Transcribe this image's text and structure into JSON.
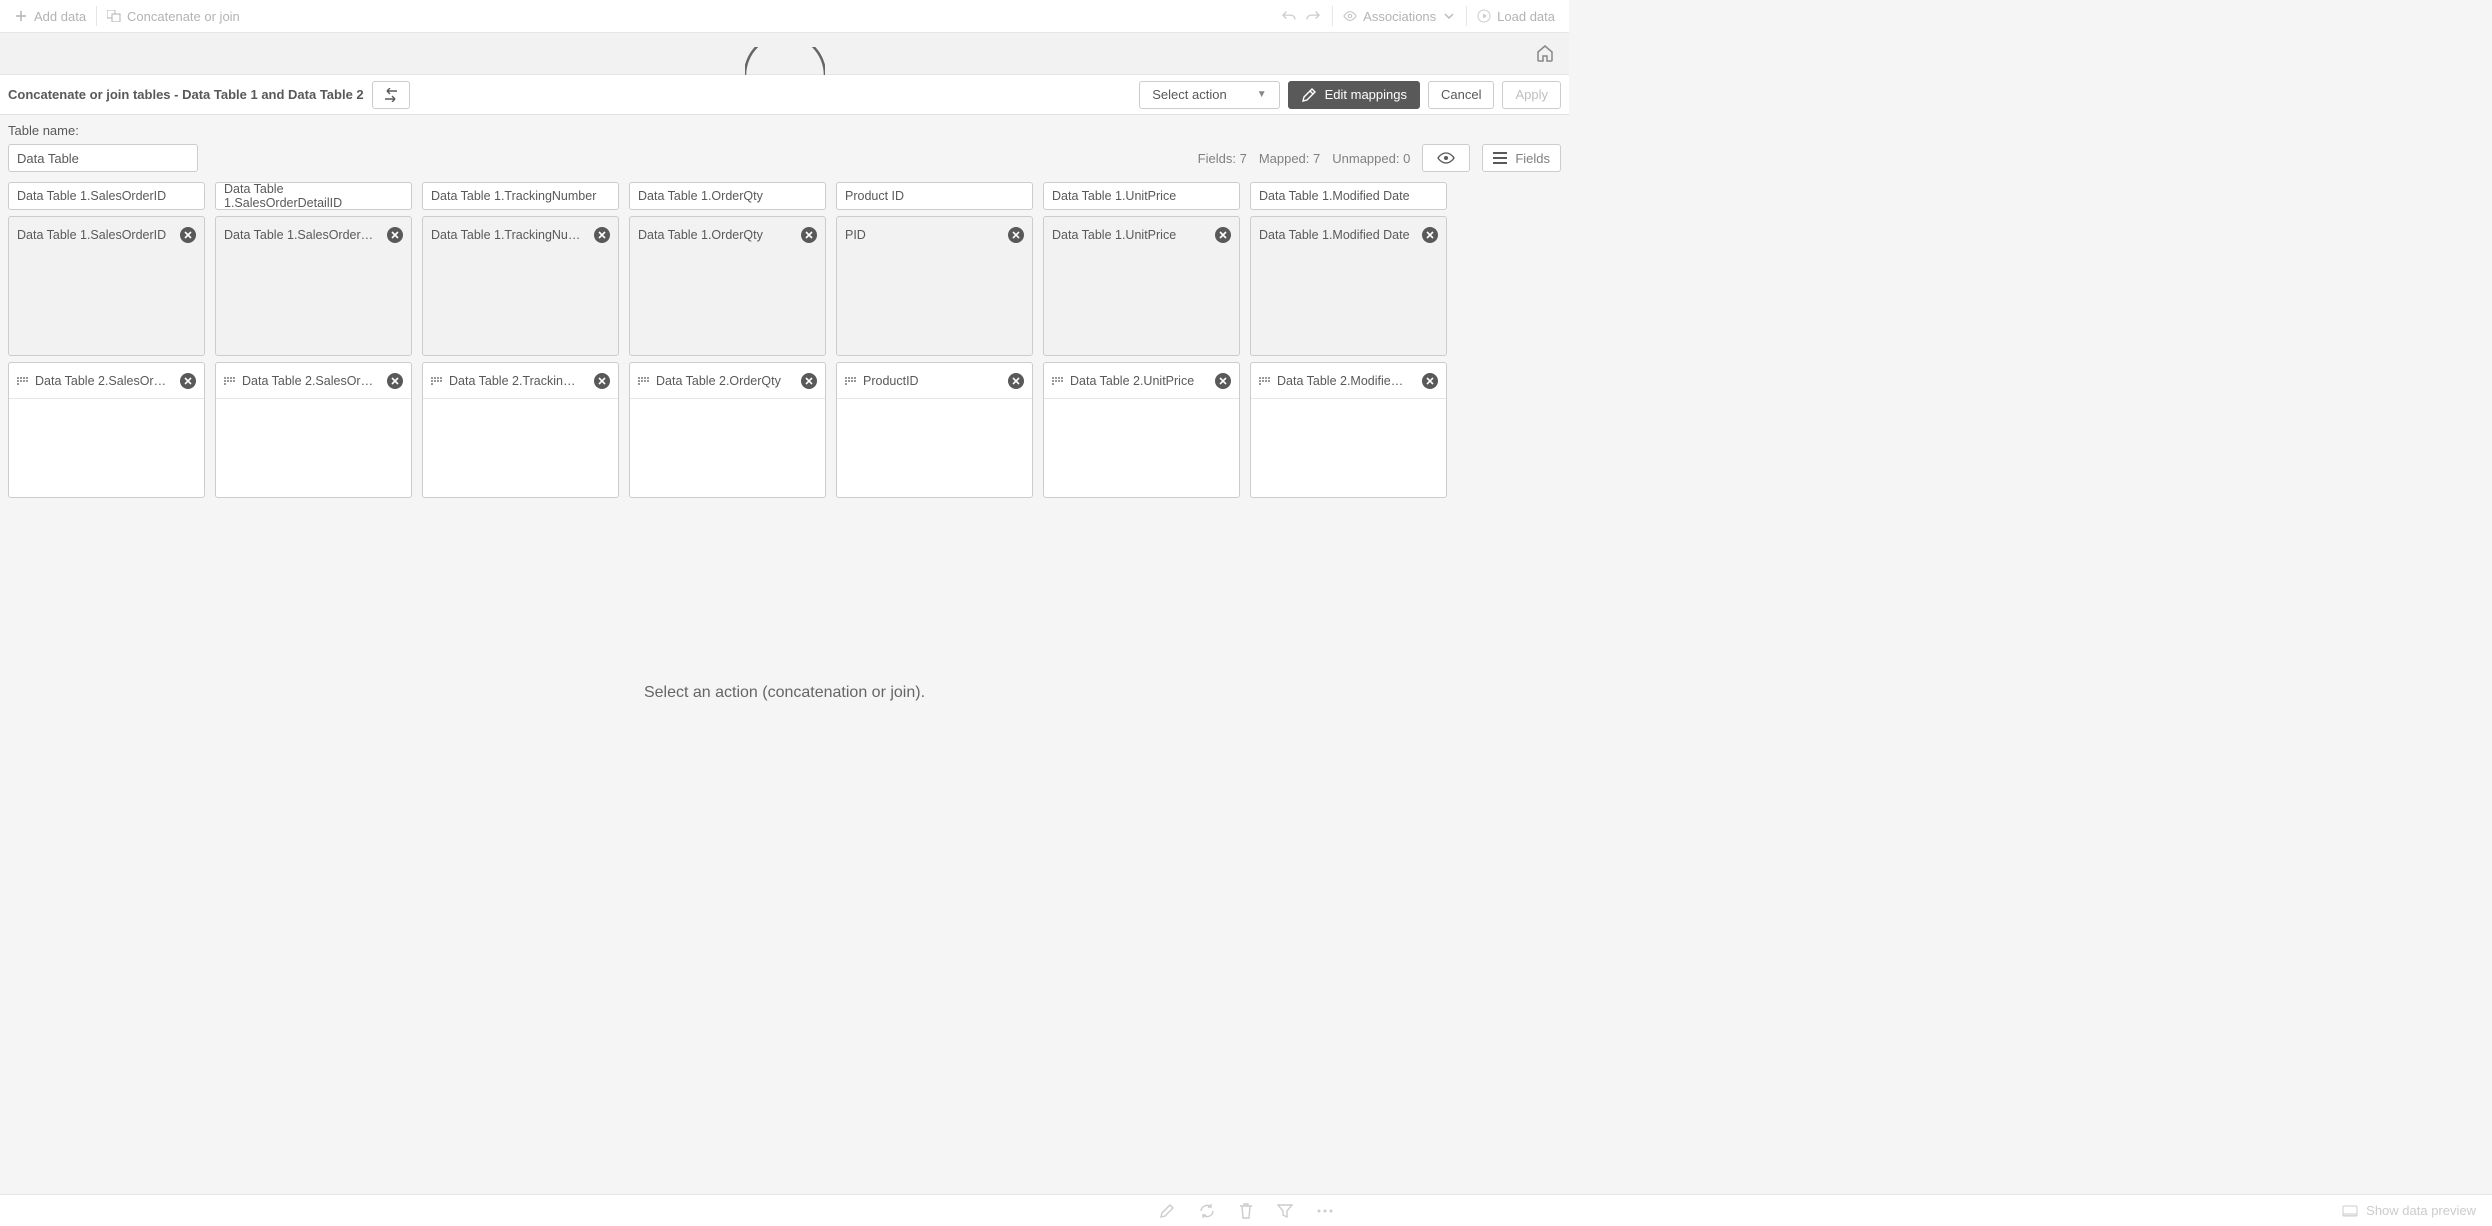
{
  "topbar": {
    "add_data": "Add data",
    "concat_join": "Concatenate or join",
    "associations": "Associations",
    "load_data": "Load data"
  },
  "actionbar": {
    "title": "Concatenate or join tables - Data Table 1 and Data Table 2",
    "select_action": "Select action",
    "edit_mappings": "Edit mappings",
    "cancel": "Cancel",
    "apply": "Apply"
  },
  "table_name": {
    "label": "Table name:",
    "value": "Data Table"
  },
  "stats": {
    "fields": "Fields: 7",
    "mapped": "Mapped: 7",
    "unmapped": "Unmapped: 0",
    "fields_btn": "Fields"
  },
  "columns": [
    {
      "header": "Data Table 1.SalesOrderID",
      "t1": "Data Table 1.SalesOrderID",
      "t2": "Data Table 2.SalesOr…"
    },
    {
      "header": "Data Table 1.SalesOrderDetailID",
      "t1": "Data Table 1.SalesOrder…",
      "t2": "Data Table 2.SalesOr…"
    },
    {
      "header": "Data Table 1.TrackingNumber",
      "t1": "Data Table 1.TrackingNu…",
      "t2": "Data Table 2.Trackin…"
    },
    {
      "header": "Data Table 1.OrderQty",
      "t1": "Data Table 1.OrderQty",
      "t2": "Data Table 2.OrderQty"
    },
    {
      "header": "Product ID",
      "t1": "PID",
      "t2": "ProductID"
    },
    {
      "header": "Data Table 1.UnitPrice",
      "t1": "Data Table 1.UnitPrice",
      "t2": "Data Table 2.UnitPrice"
    },
    {
      "header": "Data Table 1.Modified Date",
      "t1": "Data Table 1.Modified Date",
      "t2": "Data Table 2.Modifie…"
    }
  ],
  "hint": "Select an action (concatenation or join).",
  "bottombar": {
    "preview": "Show data preview"
  }
}
